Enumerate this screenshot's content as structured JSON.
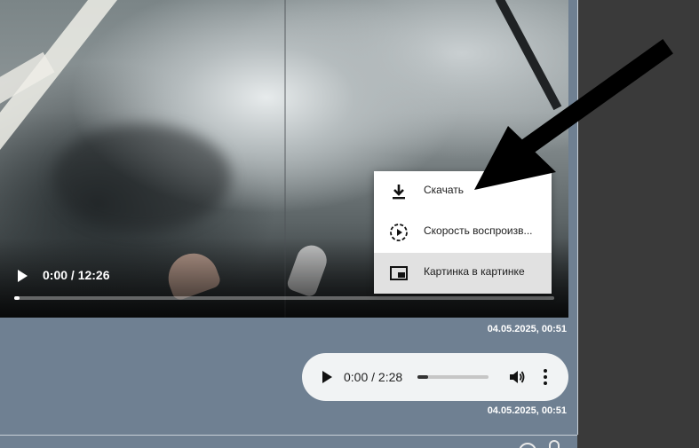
{
  "video": {
    "time": "0:00 / 12:26",
    "progress": 0.01
  },
  "context_menu": {
    "items": [
      {
        "label": "Скачать",
        "icon": "download-icon"
      },
      {
        "label": "Скорость воспроизв...",
        "icon": "playback-speed-icon"
      },
      {
        "label": "Картинка в картинке",
        "icon": "picture-in-picture-icon",
        "highlighted": true
      }
    ]
  },
  "messages": {
    "video_timestamp": "04.05.2025, 00:51",
    "audio_timestamp": "04.05.2025, 00:51"
  },
  "audio": {
    "time": "0:00 / 2:28",
    "progress": 0.15
  },
  "colors": {
    "chat_bg": "#6f8092",
    "menu_highlight": "#e1e1e1",
    "sidebar_bg": "#3a3a3a"
  }
}
